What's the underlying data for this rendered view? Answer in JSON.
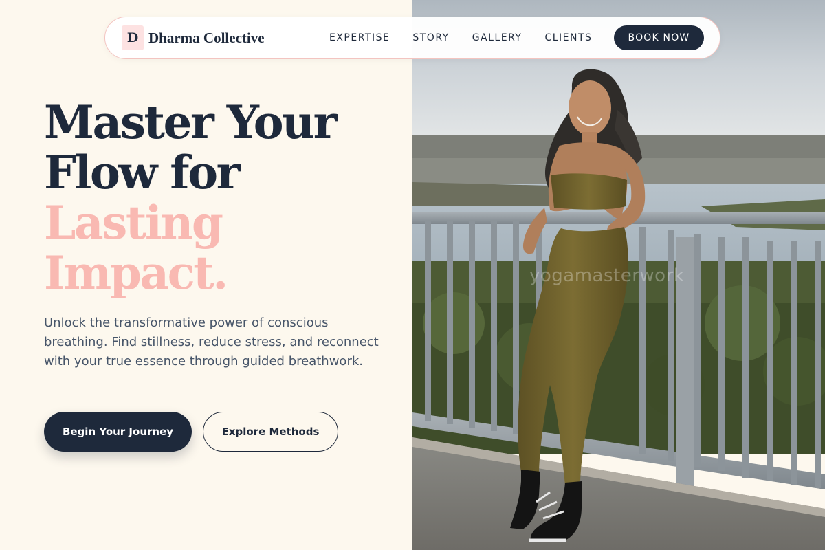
{
  "nav": {
    "logo_mark": "D",
    "brand_name": "Dharma Collective",
    "links": [
      "EXPERTISE",
      "STORY",
      "GALLERY",
      "CLIENTS"
    ],
    "cta_label": "BOOK NOW"
  },
  "hero": {
    "heading_dark": [
      "Master Your",
      "Flow for"
    ],
    "heading_accent": [
      "Lasting",
      "Impact."
    ],
    "subtitle": "Unlock the transformative power of conscious breathing. Find stillness, reduce stress, and reconnect with your true essence through guided breathwork.",
    "primary_button": "Begin Your Journey",
    "secondary_button": "Explore Methods"
  },
  "photo": {
    "watermark": "yogamasterwork"
  },
  "colors": {
    "background": "#fdf8ee",
    "navy": "#1e293b",
    "accent_pink": "#f9b9b2",
    "body_text": "#475569",
    "nav_border": "#f3c4c0"
  }
}
